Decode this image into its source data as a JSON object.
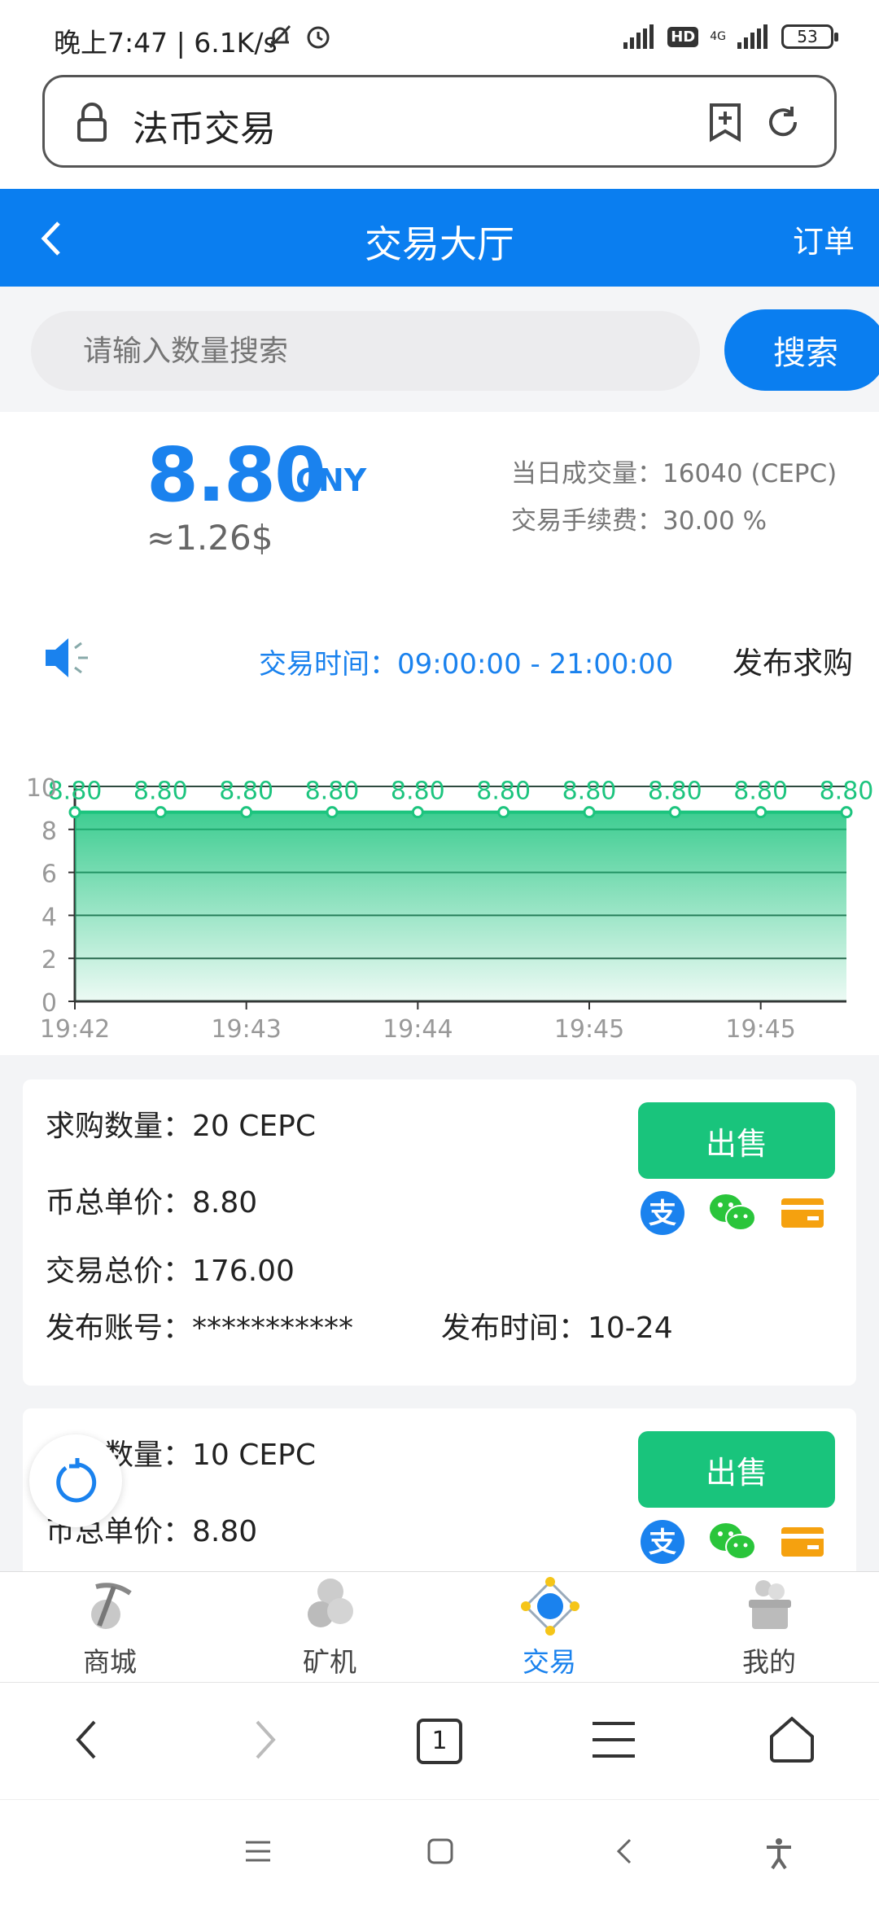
{
  "status_bar": {
    "time": "晚上7:47 | 6.1K/s",
    "hd": "HD",
    "network": "4G",
    "battery": "53"
  },
  "url_bar": {
    "title": "法币交易"
  },
  "header": {
    "title": "交易大厅",
    "orders": "订单"
  },
  "search": {
    "placeholder": "请输入数量搜索",
    "button": "搜索"
  },
  "price": {
    "value": "8.80",
    "unit": "CNY",
    "usd": "≈1.26$",
    "volume": "当日成交量：16040 (CEPC)",
    "fee": "交易手续费：30.00 %"
  },
  "trade_time": "交易时间：09:00:00 - 21:00:00",
  "publish_buy": "发布求购",
  "chart_data": {
    "type": "area",
    "x": [
      "19:42",
      "19:42",
      "19:43",
      "19:43",
      "19:44",
      "19:44",
      "19:45",
      "19:45",
      "19:45",
      "19:45"
    ],
    "xtick_labels": [
      "19:42",
      "19:43",
      "19:44",
      "19:45",
      "19:45"
    ],
    "series": [
      {
        "values": [
          8.8,
          8.8,
          8.8,
          8.8,
          8.8,
          8.8,
          8.8,
          8.8,
          8.8,
          8.8
        ]
      }
    ],
    "data_labels": [
      "8.80",
      "8.80",
      "8.80",
      "8.80",
      "8.80",
      "8.80",
      "8.80",
      "8.80",
      "8.80",
      "8.80"
    ],
    "yticks": [
      "0",
      "2",
      "4",
      "6",
      "8",
      "10"
    ],
    "ylim": [
      0,
      10
    ],
    "grid": true,
    "line_color": "#1cc47e"
  },
  "orders": [
    {
      "qty": "求购数量：20 CEPC",
      "unit_price": "币总单价：8.80",
      "total": "交易总价：176.00",
      "account": "发布账号：***********",
      "pub_time": "发布时间：10-24",
      "sell": "出售"
    },
    {
      "qty": "求购数量：10 CEPC",
      "unit_price": "币总单价：8.80",
      "sell": "出售"
    }
  ],
  "bottom_nav": [
    {
      "label": "商城"
    },
    {
      "label": "矿机"
    },
    {
      "label": "交易"
    },
    {
      "label": "我的"
    }
  ],
  "browser": {
    "tabs_count": "1"
  },
  "colors": {
    "primary": "#0a7ef0",
    "green": "#19c47c",
    "alipay": "#1a82ee",
    "wechat": "#2ac53b",
    "card": "#f5a10f"
  }
}
